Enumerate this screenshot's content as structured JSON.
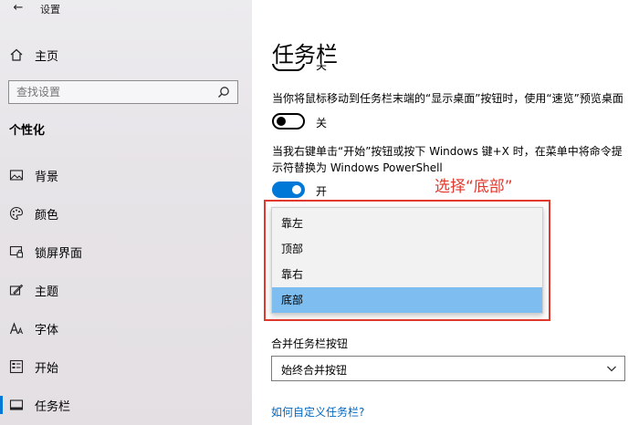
{
  "app": {
    "title": "设置",
    "back_glyph": "←"
  },
  "sidebar": {
    "home_label": "主页",
    "search_placeholder": "查找设置",
    "section_title": "个性化",
    "items": [
      {
        "label": "背景",
        "icon": "picture-icon"
      },
      {
        "label": "颜色",
        "icon": "palette-icon"
      },
      {
        "label": "锁屏界面",
        "icon": "lockscreen-icon"
      },
      {
        "label": "主题",
        "icon": "theme-icon"
      },
      {
        "label": "字体",
        "icon": "font-icon"
      },
      {
        "label": "开始",
        "icon": "start-icon"
      },
      {
        "label": "任务栏",
        "icon": "taskbar-icon",
        "active": true
      }
    ]
  },
  "main": {
    "page_title": "任务栏",
    "clipped_toggle_label": "关",
    "peek_setting": {
      "description": "当你将鼠标移动到任务栏末端的“显示桌面”按钮时，使用“速览”预览桌面",
      "state": "关"
    },
    "powershell_setting": {
      "description_line1": "当我右键单击“开始”按钮或按下 Windows 键+X 时，在菜单中将命令提",
      "description_line2": "示符替换为 Windows PowerShell",
      "state": "开"
    },
    "annotation": "选择“底部”",
    "location_dropdown": {
      "options": [
        "靠左",
        "顶部",
        "靠右",
        "底部"
      ],
      "selected": "底部"
    },
    "combine_buttons": {
      "label": "合并任务栏按钮",
      "value": "始终合并按钮"
    },
    "help_link": "如何自定义任务栏?"
  },
  "colors": {
    "accent": "#0078d7",
    "annotation_red": "#e0392e",
    "selected_option": "#7dbdf0",
    "link": "#0067c0"
  }
}
